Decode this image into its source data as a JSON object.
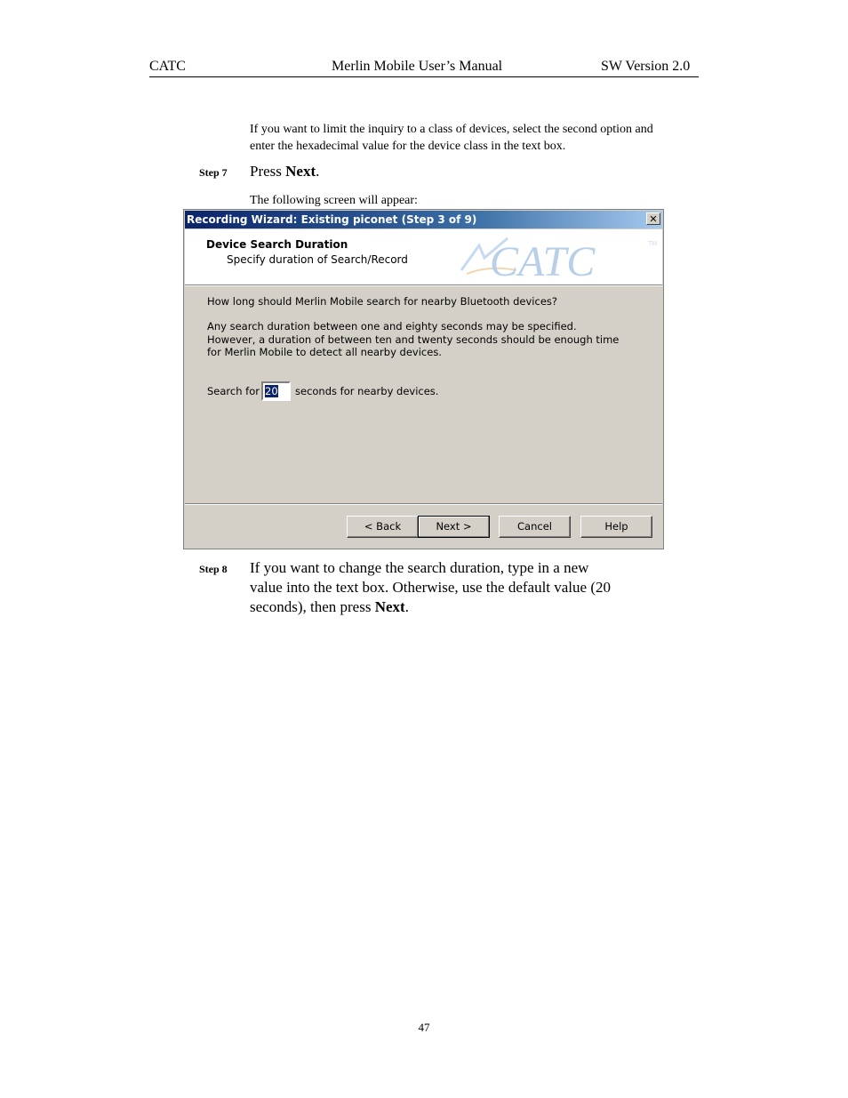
{
  "header": {
    "left": "CATC",
    "center": "Merlin Mobile User’s Manual",
    "right": "SW Version 2.0"
  },
  "intro": {
    "line1": "If you want to limit the inquiry to a class of devices, select the second option and",
    "line2": "enter the hexadecimal value for the device class in the text box."
  },
  "step7": {
    "label": "Step 7",
    "text_before": "Press ",
    "text_bold": "Next",
    "text_after": ".",
    "following": "The following screen will appear:"
  },
  "dialog": {
    "title": "Recording Wizard: Existing piconet (Step 3 of 9)",
    "close_glyph": "✕",
    "banner_title": "Device Search Duration",
    "banner_subtitle": "Specify duration of Search/Record",
    "logo_text": "CATC",
    "logo_tm": "TM",
    "question": "How long should Merlin Mobile search for nearby Bluetooth devices?",
    "info_line1": "Any search duration between one and eighty seconds may be specified.",
    "info_line2": "However, a duration of between ten and twenty seconds should be enough time",
    "info_line3": "for Merlin Mobile to detect all nearby devices.",
    "search_label": "Search for",
    "search_value": "20",
    "search_suffix": "seconds for nearby devices.",
    "buttons": {
      "back": "< Back",
      "next": "Next >",
      "cancel": "Cancel",
      "help": "Help"
    },
    "colors": {
      "title_bar": "#0a246a",
      "face": "#d4d0c8",
      "logo": "#b8cfe8",
      "logo_accent": "#f0c890"
    }
  },
  "step8": {
    "label": "Step 8",
    "line1": "If you want to change the search duration, type in a new",
    "line2": "value into the text box.  Otherwise, use the default value (20",
    "line3_before": "seconds), then press ",
    "line3_bold": "Next",
    "line3_after": "."
  },
  "page_number": "47"
}
